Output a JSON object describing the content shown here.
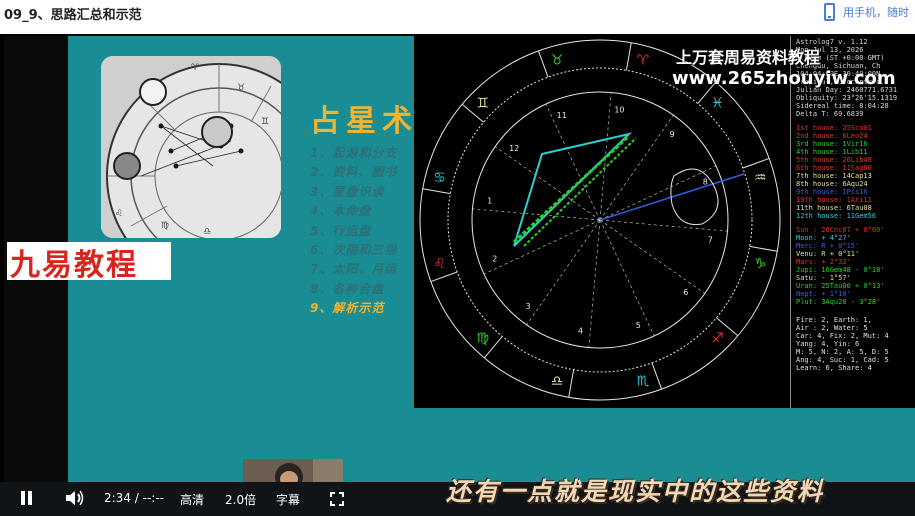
{
  "page": {
    "title": "09_9、思路汇总和示范",
    "mobile_label": "用手机，随时"
  },
  "slide": {
    "brand": "九易教程",
    "section_title": "占星术",
    "outline": [
      "1、起源和分支",
      "2、资料、图书",
      "3、星盘识读",
      "4、本命盘",
      "5、行运盘",
      "6、次限和三限",
      "7、太阳、月运",
      "8、各种合盘",
      "9、解析示范"
    ],
    "active_item": 8
  },
  "chart_overlay": {
    "watermark_line1": "上万套周易资料教程",
    "watermark_line2": "www.265zhouyiw.com",
    "info_lines": [
      "Astrolog7 v. 1.12",
      "Mon Jul 13, 2026",
      "8:00am (ST +0:00 GMT)",
      "Chengdu, Sichuan, Ch",
      "104:04:00E 30:40:00N",
      "Tropical, Geocentric,",
      "Julian Day: 2460771.6731",
      "Obliquity: 23°26'15.1319",
      "Sidereal time: 8:04:28",
      "Delta T: 69.6839"
    ],
    "house_rows": [
      {
        "label": "1st house:",
        "value": "25Sco01"
      },
      {
        "label": "2nd house:",
        "value": "6Leo24"
      },
      {
        "label": "3rd house:",
        "value": "1Vir16"
      },
      {
        "label": "4th house:",
        "value": "1Lib11"
      },
      {
        "label": "5th house:",
        "value": "26Lib49"
      },
      {
        "label": "6th house:",
        "value": "11Sag00"
      },
      {
        "label": "7th house:",
        "value": "14Cap13"
      },
      {
        "label": "8th house:",
        "value": "6Aqu24"
      },
      {
        "label": "9th house:",
        "value": "1Pis16"
      },
      {
        "label": "10th house:",
        "value": "1Ari11"
      },
      {
        "label": "11th house:",
        "value": "6Tau08"
      },
      {
        "label": "12th house:",
        "value": "11Gem56"
      }
    ],
    "planet_rows": [
      {
        "label": "Sun :",
        "value": "20Cnc07",
        "speed": "+ 0°00'"
      },
      {
        "label": "Moon:",
        "value": "",
        "speed": "+ 4°27'"
      },
      {
        "label": "Merc:",
        "value": "",
        "speed": "R + 0°15'"
      },
      {
        "label": "Venu:",
        "value": "",
        "speed": "R + 0°11'"
      },
      {
        "label": "Mars:",
        "value": "",
        "speed": "+ 2°32'"
      },
      {
        "label": "Jupi:",
        "value": "16Gem48",
        "speed": "- 0°18'"
      },
      {
        "label": "Satu:",
        "value": "",
        "speed": "- 1°57'"
      },
      {
        "label": "Uran:",
        "value": "25Tau00",
        "speed": "+ 0°13'"
      },
      {
        "label": "Nept:",
        "value": "",
        "speed": "+ 1°10'"
      },
      {
        "label": "Plut:",
        "value": "3Aqu28",
        "speed": "- 3°28'"
      }
    ],
    "element_lines": [
      "Fire: 2, Earth: 1,",
      "Air : 2, Water: 5",
      "Car: 4, Fix: 2, Mut: 4",
      "Yang: 4, Yin: 6",
      "M: 5, N: 2, A: 5, D: 5",
      "Ang: 4, Suc: 1, Cad: 5",
      "Learn: 6, Share: 4"
    ],
    "house_numbers": [
      "1",
      "2",
      "3",
      "4",
      "5",
      "6",
      "7",
      "8",
      "9",
      "10",
      "11",
      "12"
    ]
  },
  "controls": {
    "time": "2:34 / --:--",
    "quality": "高清",
    "speed": "2.0倍",
    "captions": "字幕"
  },
  "subtitle": "还有一点就是现实中的这些资料",
  "colors": {
    "slide_bg": "#198c94",
    "accent_gold": "#f0b430",
    "brand_red": "#d8261e",
    "link_blue": "#4a7bd6"
  }
}
